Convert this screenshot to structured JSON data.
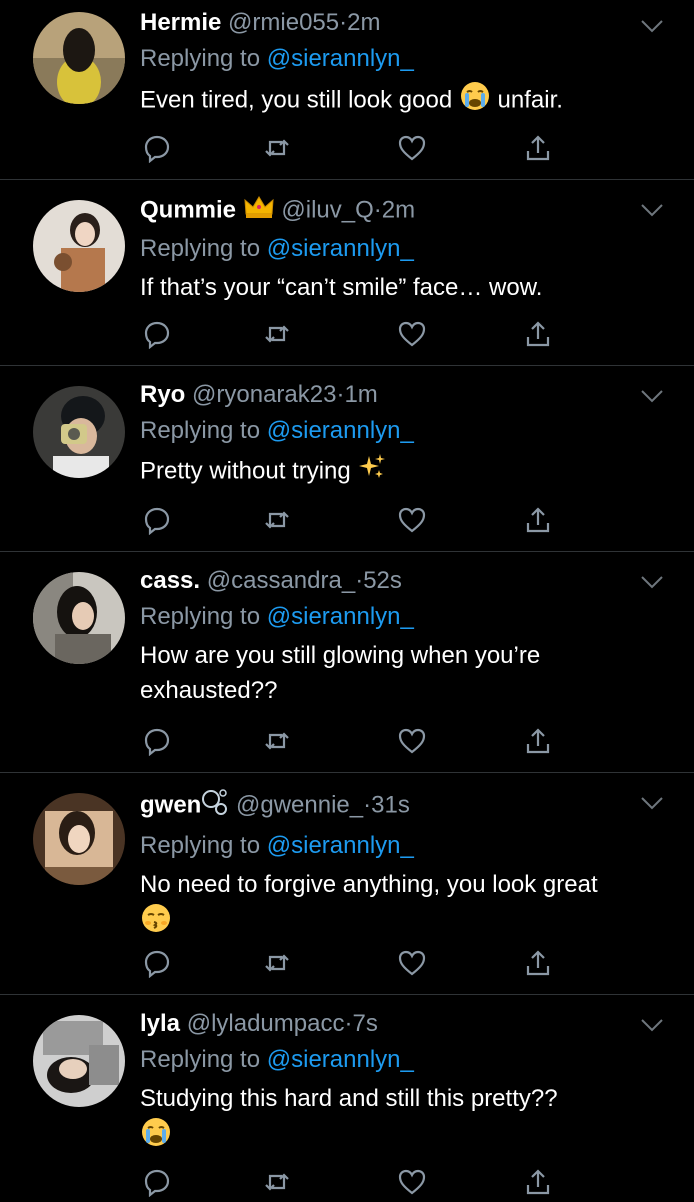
{
  "replies": [
    {
      "name": "Hermie",
      "handle": "@rmie055",
      "time": "2m",
      "replying_prefix": "Replying to",
      "replying_to": "@sierannlyn_",
      "text": "Even tired, you still look good",
      "trail_emoji": "crying-face",
      "text_after": "unfair.",
      "name_badge": ""
    },
    {
      "name": "Qummie",
      "handle": "@iluv_Q",
      "time": "2m",
      "replying_prefix": "Replying to",
      "replying_to": "@sierannlyn_",
      "text": "If that’s your “can’t smile” face… wow.",
      "name_badge": "crown"
    },
    {
      "name": "Ryo",
      "handle": "@ryonarak23",
      "time": "1m",
      "replying_prefix": "Replying to",
      "replying_to": "@sierannlyn_",
      "text": "Pretty without trying",
      "trail_emoji": "sparkles"
    },
    {
      "name": "cass.",
      "handle": "@cassandra_",
      "time": "52s",
      "replying_prefix": "Replying to",
      "replying_to": "@sierannlyn_",
      "text": "How are you still glowing when you’re exhausted??"
    },
    {
      "name": "gwen",
      "handle": "@gwennie_",
      "time": "31s",
      "replying_prefix": "Replying to",
      "replying_to": "@sierannlyn_",
      "text": "No need to forgive anything, you look great",
      "trail_emoji": "kissing-face",
      "name_badge": "bubbles"
    },
    {
      "name": "lyla",
      "handle": "@lyladumpacc",
      "time": "7s",
      "replying_prefix": "Replying to",
      "replying_to": "@sierannlyn_",
      "text": "Studying this hard and still this pretty??",
      "trail_emoji": "crying-face"
    }
  ],
  "colors": {
    "background": "#000000",
    "text": "#ffffff",
    "secondary": "#8b98a5",
    "mention": "#1d9bf0",
    "divider": "#2f3336"
  },
  "icons": [
    "reply-icon",
    "retweet-icon",
    "like-icon",
    "share-icon",
    "chevron-down-icon"
  ]
}
